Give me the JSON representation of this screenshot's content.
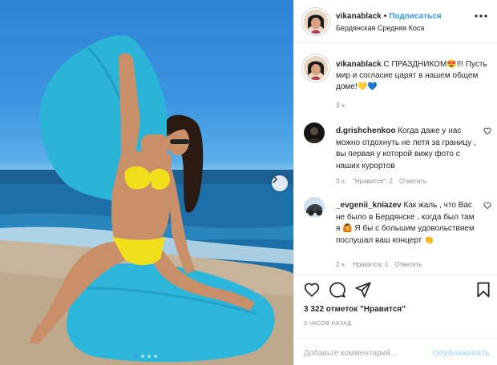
{
  "post": {
    "username": "vikanablack",
    "follow_label": "Подписаться",
    "location": "Бердянская Средняя Коса",
    "photo_count": 4,
    "active_photo": 1
  },
  "caption": {
    "username": "vikanablack",
    "text": "С ПРАЗДНИКОМ😍!!! Пусть мир и согласие царят в нашем общем доме!💛💙",
    "time": "3 ч."
  },
  "comments": [
    {
      "username": "d.grishchenkoo",
      "text": "Когда даже у нас можно отдохнуть не летя за границу , вы первая у которой вижу фото с наших курортов",
      "time": "3 ч.",
      "likes": "\"Нравится\": 2",
      "reply": "Ответить"
    },
    {
      "username": "_evgenii_kniazev",
      "text": "Как жаль , что Вас не было в Бердянске , когда был там я 🙆 Я бы с большим удовольствием послушал ваш концерт 👏",
      "time": "2 ч.",
      "likes": "Нравится: 1",
      "reply": "Ответить"
    }
  ],
  "stats": {
    "likes": "3 322 отметок \"Нравится\"",
    "ago": "3 ЧАСОВ НАЗАД"
  },
  "composer": {
    "placeholder": "Добавьте комментарий...",
    "publish": "Опубликовать"
  },
  "icons": [
    "more-icon",
    "heart-icon",
    "comment-icon",
    "share-icon",
    "bookmark-icon",
    "next-arrow-icon"
  ]
}
